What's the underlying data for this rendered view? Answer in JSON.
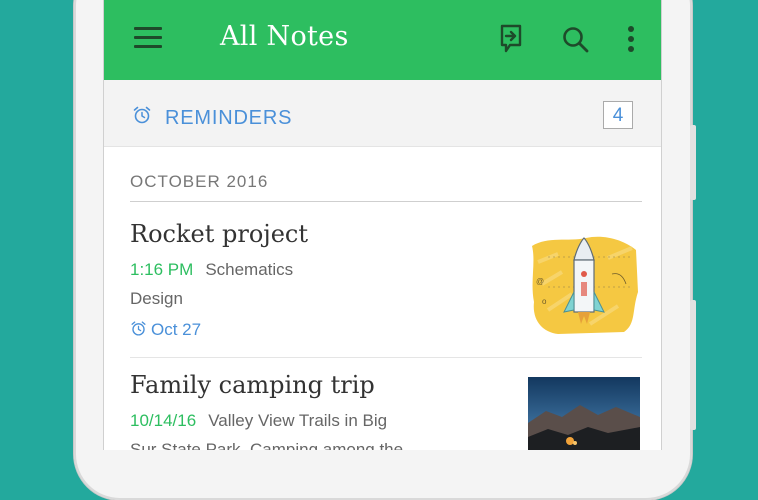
{
  "header": {
    "title": "All Notes",
    "icons": [
      "menu-icon",
      "share-icon",
      "search-icon",
      "more-icon"
    ]
  },
  "reminders": {
    "label": "REMINDERS",
    "count": "4",
    "icon": "alarm-clock-icon"
  },
  "section": {
    "label": "OCTOBER 2016"
  },
  "notes": [
    {
      "title": "Rocket project",
      "date": "1:16 PM",
      "snippet": "Schematics",
      "snippet_line2": "Design",
      "reminder": "Oct 27"
    },
    {
      "title": "Family camping trip",
      "date": "10/14/16",
      "snippet": "Valley View Trails in Big",
      "snippet_line2": "Sur State Park. Camping among the"
    }
  ],
  "colors": {
    "accent_green": "#2dbe60",
    "reminder_blue": "#4a90d9",
    "background_teal": "#23a99d"
  }
}
